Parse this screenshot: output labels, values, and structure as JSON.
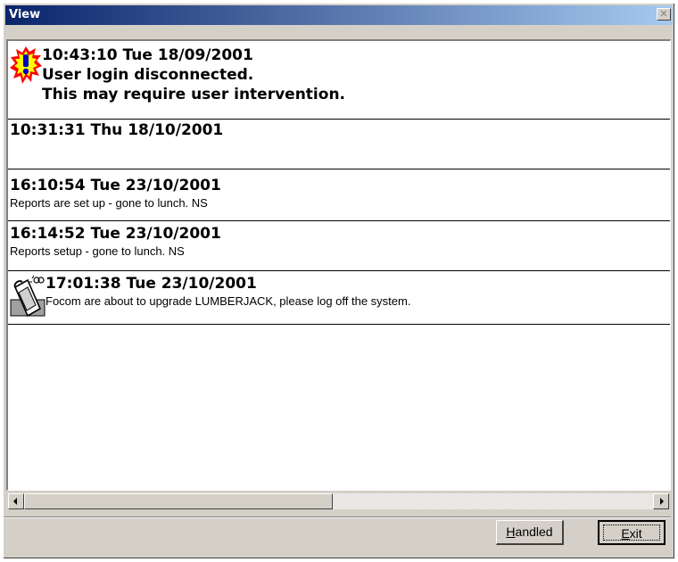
{
  "window": {
    "title": "View",
    "close_glyph": "✕"
  },
  "messages": [
    {
      "icon": "alert-icon",
      "timestamp": "10:43:10 Tue 18/09/2001",
      "line1": "User login disconnected.",
      "line2": "This may require user intervention."
    },
    {
      "icon": "",
      "timestamp": "10:31:31 Thu 18/10/2001",
      "line1": ""
    },
    {
      "icon": "",
      "timestamp": "16:10:54 Tue 23/10/2001",
      "line1": "Reports are set up - gone to lunch. NS"
    },
    {
      "icon": "",
      "timestamp": "16:14:52 Tue 23/10/2001",
      "line1": "Reports setup - gone to lunch. NS"
    },
    {
      "icon": "phone-icon",
      "timestamp": "17:01:38 Tue 23/10/2001",
      "line1": "Focom are about to upgrade LUMBERJACK, please log off the system."
    }
  ],
  "buttons": {
    "handled": "Handled",
    "exit": "Exit"
  },
  "colors": {
    "title_start": "#0a246a",
    "title_end": "#a6caf0",
    "face": "#d4d0c8",
    "alert_yellow": "#ffff00",
    "alert_red": "#ff0000",
    "alert_blue": "#0000c0"
  }
}
